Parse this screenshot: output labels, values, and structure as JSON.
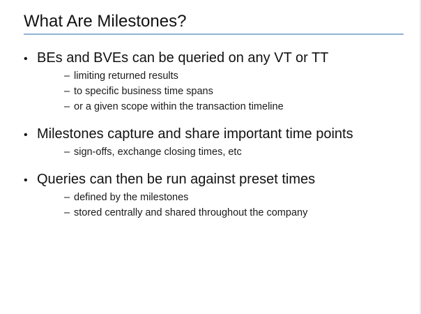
{
  "slide": {
    "title": "What Are Milestones?",
    "bullet_glyph": "•",
    "dash_glyph": "–",
    "colors": {
      "title_rule": "#8fb2d4",
      "text": "#111111",
      "background": "#ffffff"
    },
    "bullets": [
      {
        "text": "BEs and BVEs can be queried on any VT or TT",
        "subs": [
          "limiting returned results",
          "to specific business time spans",
          "or a given scope within the transaction timeline"
        ]
      },
      {
        "text": "Milestones capture and share important time points",
        "subs": [
          "sign-offs, exchange closing times, etc"
        ]
      },
      {
        "text": "Queries can then be run against preset times",
        "subs": [
          "defined by the milestones",
          "stored centrally and shared throughout the company"
        ]
      }
    ]
  }
}
